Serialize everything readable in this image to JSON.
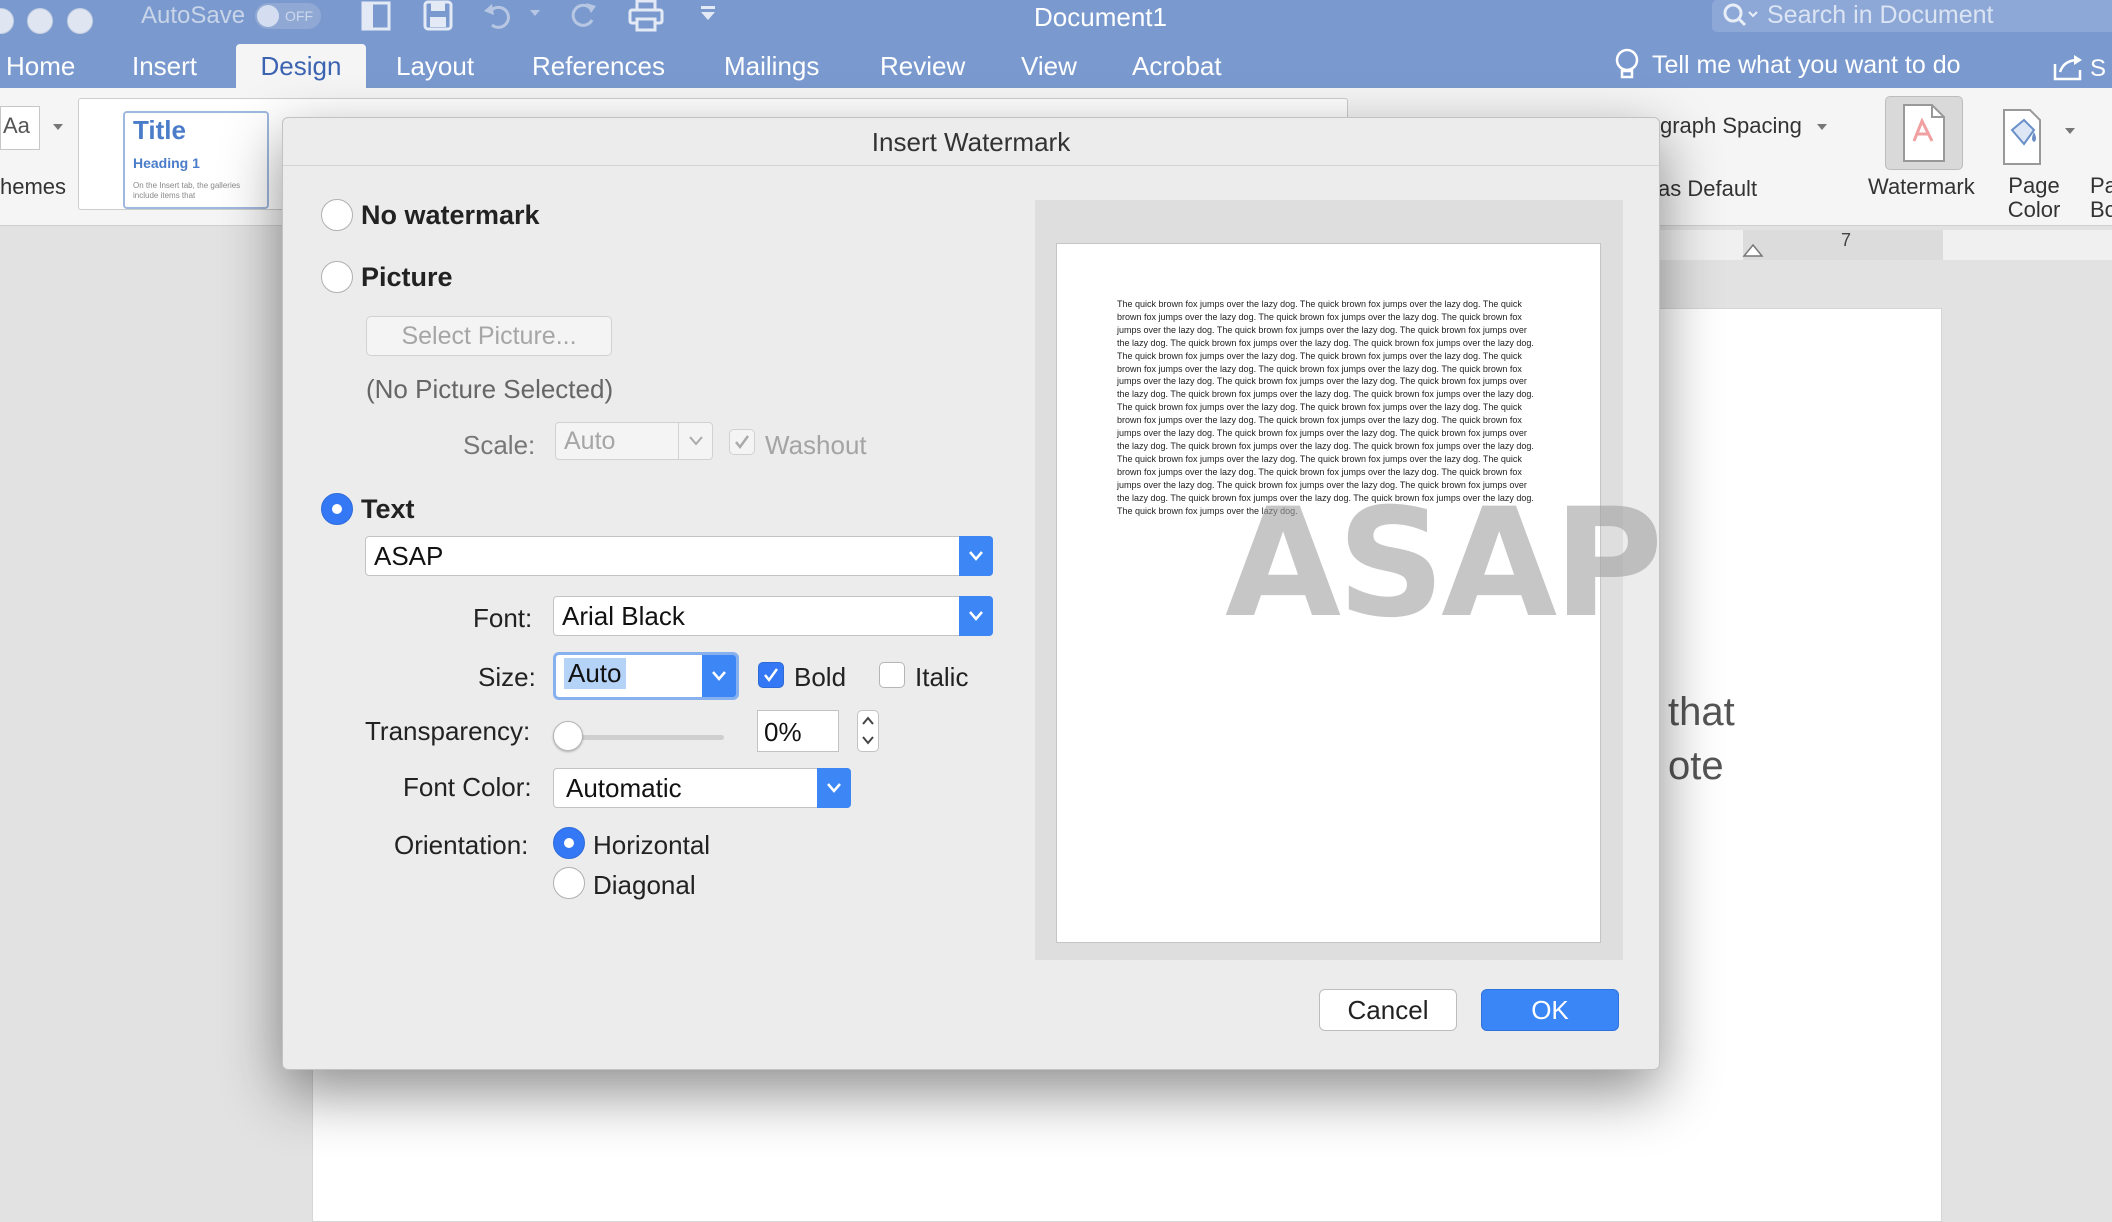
{
  "app": {
    "title": "Document1",
    "autosave_label": "AutoSave",
    "autosave_state": "OFF",
    "search_placeholder": "Search in Document",
    "tell_me": "Tell me what you want to do"
  },
  "tabs": [
    {
      "label": "Home",
      "active": false
    },
    {
      "label": "Insert",
      "active": false
    },
    {
      "label": "Design",
      "active": true
    },
    {
      "label": "Layout",
      "active": false
    },
    {
      "label": "References",
      "active": false
    },
    {
      "label": "Mailings",
      "active": false
    },
    {
      "label": "Review",
      "active": false
    },
    {
      "label": "View",
      "active": false
    },
    {
      "label": "Acrobat",
      "active": false
    }
  ],
  "ribbon": {
    "themes_label": "hemes",
    "themes_icon_text": "Aa",
    "style_title": "Title",
    "style_heading": "Heading 1",
    "style_snippet": "On the Insert tab, the galleries include items that",
    "paragraph_spacing": "graph Spacing",
    "set_default": "as Default",
    "watermark": "Watermark",
    "page_color": "Page Color",
    "page_borders": "Pa Bo"
  },
  "ruler": {
    "mark": "7"
  },
  "document": {
    "line1": "that",
    "line2": "ote"
  },
  "dialog": {
    "title": "Insert Watermark",
    "no_watermark": "No watermark",
    "picture": "Picture",
    "select_picture": "Select Picture...",
    "no_picture_selected": "(No Picture Selected)",
    "scale_label": "Scale:",
    "scale_value": "Auto",
    "washout_label": "Washout",
    "washout_checked": true,
    "text_option": "Text",
    "selected_option": "Text",
    "text_value": "ASAP",
    "font_label": "Font:",
    "font_value": "Arial Black",
    "size_label": "Size:",
    "size_value": "Auto",
    "bold_label": "Bold",
    "bold_checked": true,
    "italic_label": "Italic",
    "italic_checked": false,
    "transparency_label": "Transparency:",
    "transparency_value": "0%",
    "transparency_fraction": 0,
    "font_color_label": "Font Color:",
    "font_color_value": "Automatic",
    "orientation_label": "Orientation:",
    "orientation_horizontal": "Horizontal",
    "orientation_diagonal": "Diagonal",
    "orientation_selected": "Horizontal",
    "preview_watermark": "ASAP",
    "preview_sample": "The quick brown fox jumps over the lazy dog.",
    "preview_sentence_count": 37,
    "cancel": "Cancel",
    "ok": "OK"
  },
  "colors": {
    "titlebar": "#7a9acf",
    "accent": "#3478f6",
    "dialog_bg": "#ececec"
  }
}
